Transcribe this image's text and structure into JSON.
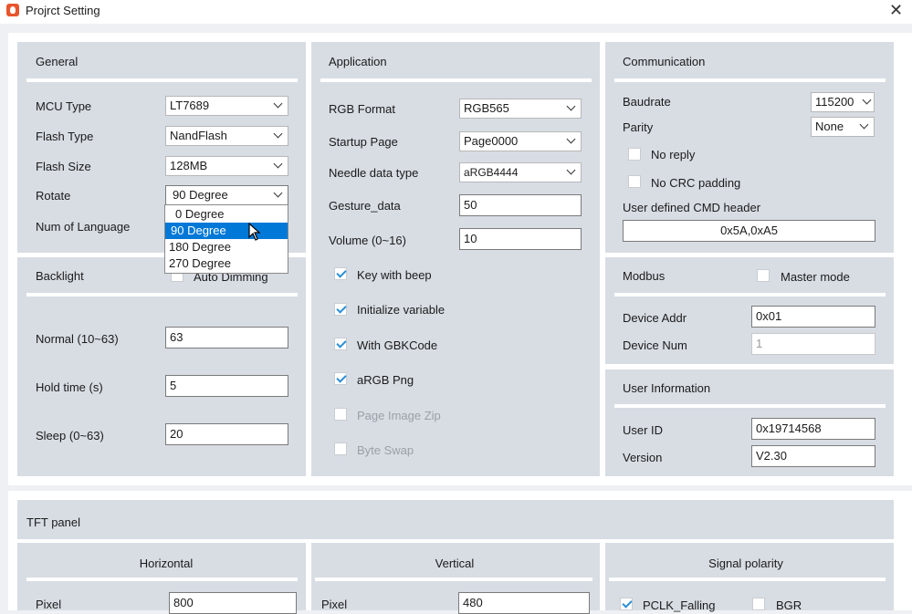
{
  "window": {
    "title": "Projrct Setting"
  },
  "general": {
    "title": "General",
    "mcu_type_label": "MCU Type",
    "mcu_type_value": "LT7689",
    "flash_type_label": "Flash Type",
    "flash_type_value": "NandFlash",
    "flash_size_label": "Flash Size",
    "flash_size_value": "128MB",
    "rotate_label": "Rotate",
    "rotate_value": "90 Degree",
    "num_lang_label": "Num of Language",
    "rotate_options": [
      "0 Degree",
      "90 Degree",
      "180 Degree",
      "270 Degree"
    ]
  },
  "backlight": {
    "title": "Backlight",
    "auto_dimming_label": "Auto Dimming",
    "normal_label": "Normal (10~63)",
    "normal_value": "63",
    "hold_label": "Hold time (s)",
    "hold_value": "5",
    "sleep_label": "Sleep (0~63)",
    "sleep_value": "20"
  },
  "application": {
    "title": "Application",
    "rgb_label": "RGB Format",
    "rgb_value": "RGB565",
    "startup_label": "Startup Page",
    "startup_value": "Page0000",
    "needle_label": "Needle data type",
    "needle_value": "aRGB4444",
    "gesture_label": "Gesture_data",
    "gesture_value": "50",
    "volume_label": "Volume (0~16)",
    "volume_value": "10",
    "checks": [
      {
        "label": "Key with beep",
        "checked": true
      },
      {
        "label": "Initialize variable",
        "checked": true
      },
      {
        "label": "With GBKCode",
        "checked": true
      },
      {
        "label": "aRGB Png",
        "checked": true
      },
      {
        "label": "Page Image Zip",
        "checked": false
      },
      {
        "label": "Byte Swap",
        "checked": false
      }
    ]
  },
  "communication": {
    "title": "Communication",
    "baud_label": "Baudrate",
    "baud_value": "115200",
    "parity_label": "Parity",
    "parity_value": "None",
    "no_reply_label": "No reply",
    "no_crc_label": "No CRC padding",
    "cmd_header_label": "User defined CMD header",
    "cmd_header_value": "0x5A,0xA5"
  },
  "modbus": {
    "title": "Modbus",
    "master_label": "Master mode",
    "addr_label": "Device Addr",
    "addr_value": "0x01",
    "num_label": "Device Num",
    "num_value": "1"
  },
  "user_info": {
    "title": "User Information",
    "id_label": "User ID",
    "id_value": "0x19714568",
    "version_label": "Version",
    "version_value": "V2.30"
  },
  "tft": {
    "title": "TFT panel",
    "horizontal": {
      "title": "Horizontal",
      "pixel_label": "Pixel",
      "pixel_value": "800"
    },
    "vertical": {
      "title": "Vertical",
      "pixel_label": "Pixel",
      "pixel_value": "480"
    },
    "signal": {
      "title": "Signal polarity",
      "pclk_label": "PCLK_Falling",
      "bgr_label": "BGR"
    }
  }
}
